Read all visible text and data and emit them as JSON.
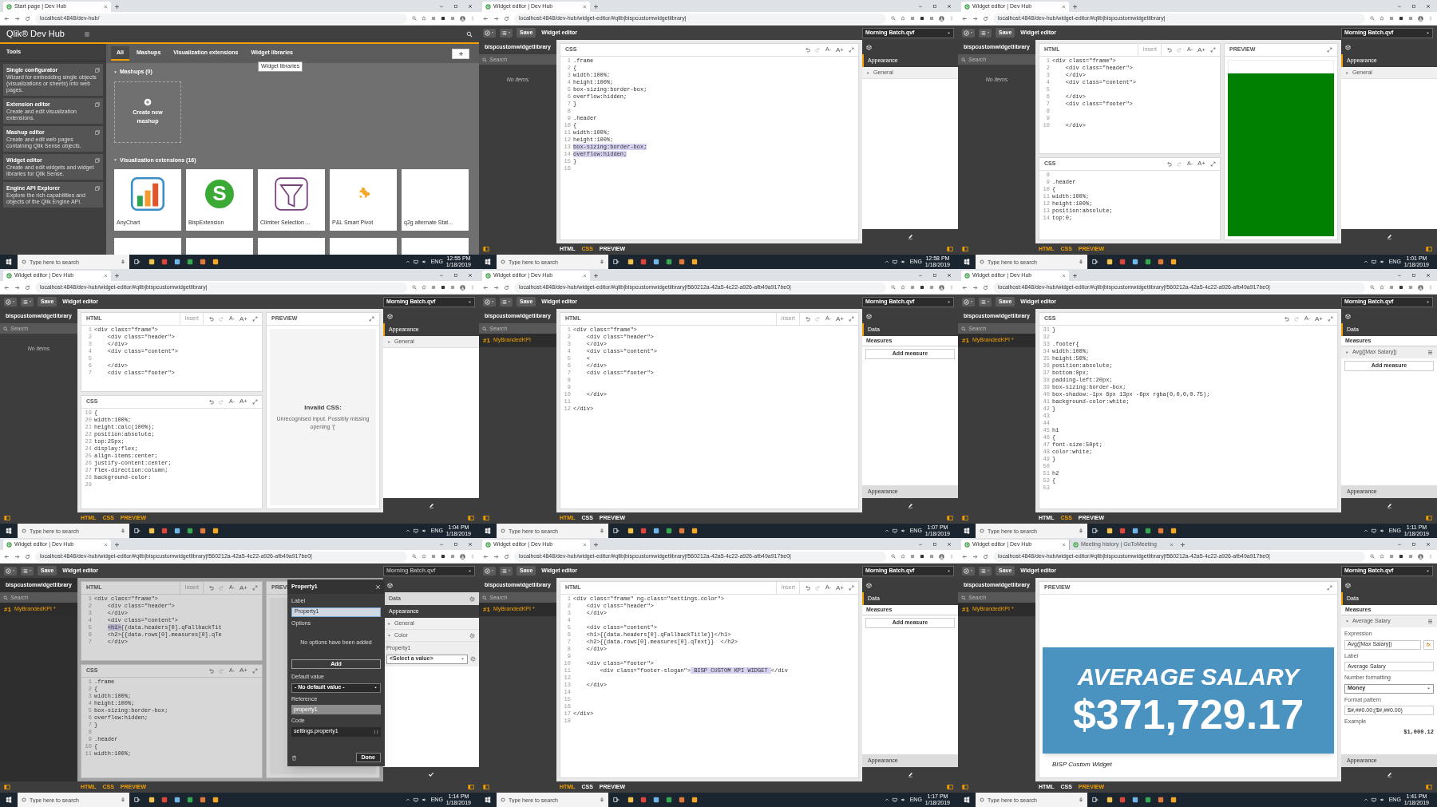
{
  "tiles": [
    {
      "kind": "devhub",
      "browser": {
        "tabs": [
          {
            "title": "Start page | Dev Hub",
            "selected": true
          }
        ],
        "url": "localhost:4848/dev-hub/"
      },
      "brand": "Qlik® Dev Hub",
      "tools_title": "Tools",
      "tools": [
        {
          "title": "Single configurator",
          "description": "Wizard for embedding single objects (visualizations or sheets) into web pages."
        },
        {
          "title": "Extension editor",
          "description": "Create and edit visualization extensions."
        },
        {
          "title": "Mashup editor",
          "description": "Create and edit web pages containing Qlik Sense objects."
        },
        {
          "title": "Widget editor",
          "description": "Create and edit widgets and widget libraries for Qlik Sense."
        },
        {
          "title": "Engine API Explorer",
          "description": "Explore the rich capabilities and objects of the Qlik Engine API."
        }
      ],
      "filter_tabs": [
        {
          "label": "All",
          "selected": true
        },
        {
          "label": "Mashups",
          "selected": false
        },
        {
          "label": "Visualization extensions",
          "selected": false
        },
        {
          "label": "Widget libraries",
          "selected": false
        }
      ],
      "tooltip": "Widget libraries",
      "sections": [
        {
          "title": "Mashups (0)",
          "expanded": true,
          "cards": [
            {
              "kind": "create",
              "name": "Create new mashup"
            }
          ]
        },
        {
          "title": "Visualization extensions (16)",
          "expanded": true,
          "cards": [
            {
              "kind": "bars",
              "name": "AnyChart"
            },
            {
              "kind": "letter",
              "letter": "S",
              "name": "BispExtension"
            },
            {
              "kind": "funnel",
              "name": "Climber Selection ..."
            },
            {
              "kind": "puzzle",
              "name": "P&L Smart Pivot"
            },
            {
              "kind": "plain",
              "name": "q2g alternate Stat..."
            }
          ]
        }
      ],
      "taskbar": {
        "search_placeholder": "Type here to search",
        "lang": "ENG",
        "time": "12:55 PM",
        "date": "1/18/2019"
      }
    },
    {
      "kind": "editor",
      "browser": {
        "tabs": [
          {
            "title": "Widget editor | Dev Hub",
            "selected": true
          }
        ],
        "url": "localhost:4848/dev-hub/widget-editor/#qlib|bispcustomwidgetlibrary|"
      },
      "toolbar": {
        "save": "Save",
        "title": "Widget editor",
        "app": "Morning Batch.qvf"
      },
      "library": {
        "title": "bispcustomwidgetlibrary",
        "search_placeholder": "Search",
        "empty_text": "No items"
      },
      "columns": [
        {
          "panels": [
            {
              "kind": "code",
              "title": "CSS",
              "font_buttons": [
                "A-",
                "A+"
              ],
              "lines": [
                {
                  "n": "1",
                  "text": ".frame"
                },
                {
                  "n": "2",
                  "text": "{"
                },
                {
                  "n": "3",
                  "text": "width:100%;"
                },
                {
                  "n": "4",
                  "text": "height:100%;"
                },
                {
                  "n": "5",
                  "text": "box-sizing:border-box;"
                },
                {
                  "n": "6",
                  "text": "overflow:hidden;"
                },
                {
                  "n": "7",
                  "text": "}"
                },
                {
                  "n": "8"
                },
                {
                  "n": "9",
                  "text": ".header"
                },
                {
                  "n": "10",
                  "text": "{"
                },
                {
                  "n": "11",
                  "text": "width:100%;"
                },
                {
                  "n": "12",
                  "text": "height:100%;"
                },
                {
                  "n": "13",
                  "segments": [
                    {
                      "text": "box-sizing:border-box;",
                      "selected": true
                    }
                  ]
                },
                {
                  "n": "14",
                  "segments": [
                    {
                      "text": "overflow:hidden;",
                      "selected": true
                    }
                  ]
                },
                {
                  "n": "15",
                  "text": "}"
                },
                {
                  "n": "16"
                }
              ]
            }
          ]
        }
      ],
      "properties": {
        "top": [
          {
            "kind": "header",
            "label": "Appearance",
            "selected": true
          },
          {
            "kind": "section",
            "label": "General",
            "expanded": false
          }
        ],
        "footer": {
          "kind": "pencil"
        }
      },
      "view_tabs": [
        {
          "label": "HTML",
          "selected": false
        },
        {
          "label": "CSS",
          "selected": true
        },
        {
          "label": "PREVIEW",
          "selected": false
        }
      ],
      "taskbar": {
        "search_placeholder": "Type here to search",
        "lang": "ENG",
        "time": "12:58 PM",
        "date": "1/18/2019"
      }
    },
    {
      "kind": "editor",
      "browser": {
        "tabs": [
          {
            "title": "Widget editor | Dev Hub",
            "selected": true
          }
        ],
        "url": "localhost:4848/dev-hub/widget-editor/#qlib|bispcustomwidgetlibrary|"
      },
      "toolbar": {
        "save": "Save",
        "title": "Widget editor",
        "app": "Morning Batch.qvf"
      },
      "library": {
        "title": "bispcustomwidgetlibrary",
        "search_placeholder": "Search",
        "empty_text": "No items"
      },
      "columns": [
        {
          "panels": [
            {
              "kind": "code",
              "title": "HTML",
              "insert": "Insert",
              "font_buttons": [
                "A-",
                "A+"
              ],
              "lines": [
                {
                  "n": "1",
                  "text": "<div class=\"frame\">"
                },
                {
                  "n": "2",
                  "text": "    <div class=\"header\">"
                },
                {
                  "n": "3",
                  "text": "    </div>"
                },
                {
                  "n": "4",
                  "text": "    <div class=\"content\">"
                },
                {
                  "n": "5"
                },
                {
                  "n": "6",
                  "text": "    </div>"
                },
                {
                  "n": "7",
                  "text": "    <div class=\"footer\">"
                },
                {
                  "n": "8"
                },
                {
                  "n": "9"
                },
                {
                  "n": "10",
                  "text": "    </div>"
                }
              ]
            },
            {
              "kind": "code",
              "title": "CSS",
              "font_buttons": [
                "A-",
                "A+"
              ],
              "lines": [
                {
                  "n": "8"
                },
                {
                  "n": "9",
                  "text": ".header"
                },
                {
                  "n": "10",
                  "text": "{"
                },
                {
                  "n": "11",
                  "text": "width:100%;"
                },
                {
                  "n": "12",
                  "text": "height:100%;"
                },
                {
                  "n": "13",
                  "text": "position:absolute;"
                },
                {
                  "n": "14",
                  "text": "top:0;"
                }
              ]
            }
          ]
        },
        {
          "panels": [
            {
              "kind": "preview",
              "title": "PREVIEW",
              "content": {
                "kind": "solid"
              }
            }
          ]
        }
      ],
      "properties": {
        "top": [
          {
            "kind": "header",
            "label": "Appearance",
            "selected": true
          },
          {
            "kind": "section",
            "label": "General",
            "expanded": false
          }
        ],
        "footer": {
          "kind": "pencil"
        }
      },
      "view_tabs": [
        {
          "label": "HTML",
          "selected": true
        },
        {
          "label": "CSS",
          "selected": true
        },
        {
          "label": "PREVIEW",
          "selected": true
        }
      ],
      "taskbar": {
        "search_placeholder": "Type here to search",
        "lang": "ENG",
        "time": "1:01 PM",
        "date": "1/18/2019"
      }
    },
    {
      "kind": "editor",
      "browser": {
        "tabs": [
          {
            "title": "Widget editor | Dev Hub",
            "selected": true
          }
        ],
        "url": "localhost:4848/dev-hub/widget-editor/#qlib|bispcustomwidgetlibrary|"
      },
      "toolbar": {
        "save": "Save",
        "title": "Widget editor",
        "app": "Morning Batch.qvf"
      },
      "library": {
        "title": "bispcustomwidgetlibrary",
        "search_placeholder": "Search",
        "empty_text": "No items"
      },
      "columns": [
        {
          "panels": [
            {
              "kind": "code",
              "title": "HTML",
              "insert": "Insert",
              "font_buttons": [
                "A-",
                "A+"
              ],
              "lines": [
                {
                  "n": "1",
                  "text": "<div class=\"frame\">"
                },
                {
                  "n": "2",
                  "text": "    <div class=\"header\">"
                },
                {
                  "n": "3",
                  "text": "    </div>"
                },
                {
                  "n": "4",
                  "text": "    <div class=\"content\">"
                },
                {
                  "n": "5"
                },
                {
                  "n": "6",
                  "text": "    </div>"
                },
                {
                  "n": "7",
                  "text": "    <div class=\"footer\">"
                }
              ]
            },
            {
              "kind": "code",
              "title": "CSS",
              "font_buttons": [
                "A-",
                "A+"
              ],
              "lines": [
                {
                  "n": "19",
                  "text": "{"
                },
                {
                  "n": "20",
                  "text": "width:100%;"
                },
                {
                  "n": "21",
                  "text": "height:calc(100%);"
                },
                {
                  "n": "22",
                  "text": "position:absolute;"
                },
                {
                  "n": "23",
                  "text": "top:25px;"
                },
                {
                  "n": "24",
                  "text": "display:flex;"
                },
                {
                  "n": "25",
                  "text": "align-items:center;"
                },
                {
                  "n": "26",
                  "text": "justify-content:center;"
                },
                {
                  "n": "27",
                  "text": "flex-direction:column;"
                },
                {
                  "n": "28",
                  "text": "background-color:"
                },
                {
                  "n": "29"
                }
              ]
            }
          ]
        },
        {
          "panels": [
            {
              "kind": "preview",
              "title": "PREVIEW",
              "content": {
                "kind": "message",
                "title": "Invalid CSS:",
                "text": "Unrecognised input. Possibly missing opening '{'"
              }
            }
          ]
        }
      ],
      "properties": {
        "top": [
          {
            "kind": "header",
            "label": "Appearance",
            "selected": true
          },
          {
            "kind": "section",
            "label": "General",
            "expanded": false
          }
        ],
        "footer": {
          "kind": "pencil"
        }
      },
      "view_tabs": [
        {
          "label": "HTML",
          "selected": true
        },
        {
          "label": "CSS",
          "selected": true
        },
        {
          "label": "PREVIEW",
          "selected": true
        }
      ],
      "taskbar": {
        "search_placeholder": "Type here to search",
        "lang": "ENG",
        "time": "1:04 PM",
        "date": "1/18/2019"
      }
    },
    {
      "kind": "editor",
      "browser": {
        "tabs": [
          {
            "title": "Widget editor | Dev Hub",
            "selected": true
          }
        ],
        "url": "localhost:4848/dev-hub/widget-editor/#qlib|bispcustomwidgetlibrary|f560212a-42a5-4c22-a926-afb49a917be0|"
      },
      "toolbar": {
        "save": "Save",
        "title": "Widget editor",
        "app": "Morning Batch.qvf"
      },
      "library": {
        "title": "bispcustomwidgetlibrary",
        "search_placeholder": "Search",
        "items": [
          {
            "number": "#1",
            "name": "MyBrandedKPI",
            "selected": true
          }
        ]
      },
      "columns": [
        {
          "panels": [
            {
              "kind": "code",
              "title": "HTML",
              "insert": "Insert",
              "font_buttons": [
                "A-",
                "A+"
              ],
              "lines": [
                {
                  "n": "1",
                  "text": "<div class=\"frame\">"
                },
                {
                  "n": "2",
                  "text": "    <div class=\"header\">"
                },
                {
                  "n": "3",
                  "text": "    </div>"
                },
                {
                  "n": "4",
                  "text": "    <div class=\"content\">"
                },
                {
                  "n": "5",
                  "text": "    <"
                },
                {
                  "n": "6",
                  "text": "    </div>"
                },
                {
                  "n": "7",
                  "text": "    <div class=\"footer\">"
                },
                {
                  "n": "8"
                },
                {
                  "n": "9"
                },
                {
                  "n": "10",
                  "text": "    </div>"
                },
                {
                  "n": "11"
                },
                {
                  "n": "12",
                  "text": "</div>"
                }
              ]
            }
          ]
        }
      ],
      "properties": {
        "top": [
          {
            "kind": "header",
            "label": "Data",
            "selected": true
          },
          {
            "kind": "subheader",
            "label": "Measures"
          },
          {
            "kind": "button",
            "label": "Add measure"
          }
        ],
        "bottom": [
          {
            "kind": "header",
            "label": "Appearance",
            "selected": false
          }
        ],
        "footer": {
          "kind": "pencil"
        }
      },
      "view_tabs": [
        {
          "label": "HTML",
          "selected": true
        },
        {
          "label": "CSS",
          "selected": false
        },
        {
          "label": "PREVIEW",
          "selected": false
        }
      ],
      "taskbar": {
        "search_placeholder": "Type here to search",
        "lang": "ENG",
        "time": "1:07 PM",
        "date": "1/18/2019"
      }
    },
    {
      "kind": "editor",
      "browser": {
        "tabs": [
          {
            "title": "Widget editor | Dev Hub",
            "selected": true
          }
        ],
        "url": "localhost:4848/dev-hub/widget-editor/#qlib|bispcustomwidgetlibrary|f560212a-42a5-4c22-a926-afb49a917be0|"
      },
      "toolbar": {
        "save": "Save",
        "title": "Widget editor",
        "app": "Morning Batch.qvf"
      },
      "library": {
        "title": "bispcustomwidgetlibrary",
        "search_placeholder": "Search",
        "items": [
          {
            "number": "#1",
            "name": "MyBrandedKPI *",
            "selected": true
          }
        ]
      },
      "columns": [
        {
          "panels": [
            {
              "kind": "code",
              "title": "CSS",
              "font_buttons": [
                "A-",
                "A+"
              ],
              "lines": [
                {
                  "n": "31",
                  "text": "}"
                },
                {
                  "n": "32"
                },
                {
                  "n": "33",
                  "text": ".footer{"
                },
                {
                  "n": "34",
                  "text": "width:100%;"
                },
                {
                  "n": "35",
                  "text": "height:50%;"
                },
                {
                  "n": "36",
                  "text": "position:absolute;"
                },
                {
                  "n": "37",
                  "text": "bottom:0px;"
                },
                {
                  "n": "38",
                  "text": "padding-left:20px;"
                },
                {
                  "n": "39",
                  "text": "box-sizing:border-box;"
                },
                {
                  "n": "40",
                  "text": "box-shadow:-1px 6px 13px -6px rgba(0,0,0,0.75);"
                },
                {
                  "n": "41",
                  "text": "background-color:white;"
                },
                {
                  "n": "42",
                  "text": "}"
                },
                {
                  "n": "43"
                },
                {
                  "n": "44"
                },
                {
                  "n": "45",
                  "text": "h1"
                },
                {
                  "n": "46",
                  "text": "{"
                },
                {
                  "n": "47",
                  "text": "font-size:50pt;"
                },
                {
                  "n": "48",
                  "text": "color:white;"
                },
                {
                  "n": "49",
                  "text": "}"
                },
                {
                  "n": "50"
                },
                {
                  "n": "51",
                  "text": "h2"
                },
                {
                  "n": "52",
                  "text": "{"
                },
                {
                  "n": "53"
                }
              ]
            }
          ]
        }
      ],
      "properties": {
        "top": [
          {
            "kind": "header",
            "label": "Data",
            "selected": true
          },
          {
            "kind": "subheader",
            "label": "Measures"
          },
          {
            "kind": "measure",
            "label": "Avg([Max Salary])",
            "expanded": false
          },
          {
            "kind": "button",
            "label": "Add measure"
          }
        ],
        "bottom": [
          {
            "kind": "header",
            "label": "Appearance",
            "selected": false
          }
        ],
        "footer": {
          "kind": "pencil"
        }
      },
      "view_tabs": [
        {
          "label": "HTML",
          "selected": false
        },
        {
          "label": "CSS",
          "selected": true
        },
        {
          "label": "PREVIEW",
          "selected": false
        }
      ],
      "taskbar": {
        "search_placeholder": "Type here to search",
        "lang": "ENG",
        "time": "1:11 PM",
        "date": "1/18/2019"
      }
    },
    {
      "kind": "editor",
      "browser": {
        "tabs": [
          {
            "title": "Widget editor | Dev Hub",
            "selected": true
          }
        ],
        "url": "localhost:4848/dev-hub/widget-editor/#qlib|bispcustomwidgetlibrary|f560212a-42a5-4c22-a926-afb49a917be0|"
      },
      "toolbar": {
        "save": "Save",
        "title": "Widget editor",
        "app": "Morning Batch.qvf"
      },
      "library": {
        "title": "bispcustomwidgetlibrary",
        "search_placeholder": "Search",
        "items": [
          {
            "number": "#1",
            "name": "MyBrandedKPI *",
            "selected": true
          }
        ]
      },
      "columns": [
        {
          "panels": [
            {
              "kind": "code",
              "title": "HTML",
              "insert": "Insert",
              "font_buttons": [
                "A-",
                "A+"
              ],
              "lines": [
                {
                  "n": "1",
                  "text": "<div class=\"frame\">"
                },
                {
                  "n": "2",
                  "text": "    <div class=\"header\">"
                },
                {
                  "n": "3",
                  "text": "    </div>"
                },
                {
                  "n": "4",
                  "text": "    <div class=\"content\">"
                },
                {
                  "n": "5",
                  "indented": true,
                  "segments": [
                    {
                      "text": "<h1>",
                      "selected": true
                    },
                    {
                      "text": "{{data.headers[0].qFallbackTit",
                      "selected": false
                    }
                  ]
                },
                {
                  "n": "6",
                  "text": "    <h2>{{data.rows[0].measures[0].qTe"
                },
                {
                  "n": "7",
                  "text": "    </div>"
                }
              ]
            },
            {
              "kind": "code",
              "title": "CSS",
              "font_buttons": [
                "A-",
                "A+"
              ],
              "lines": [
                {
                  "n": "1",
                  "text": ".frame"
                },
                {
                  "n": "2",
                  "text": "{"
                },
                {
                  "n": "3",
                  "text": "width:100%;"
                },
                {
                  "n": "4",
                  "text": "height:100%;"
                },
                {
                  "n": "5",
                  "text": "box-sizing:border-box;"
                },
                {
                  "n": "6",
                  "text": "overflow:hidden;"
                },
                {
                  "n": "7",
                  "text": "}"
                },
                {
                  "n": "8"
                },
                {
                  "n": "9",
                  "text": ".header"
                },
                {
                  "n": "10",
                  "text": "{"
                },
                {
                  "n": "11",
                  "text": "width:100%;"
                }
              ]
            }
          ]
        },
        {
          "panels": [
            {
              "kind": "preview",
              "title": "PREVI",
              "content": {
                "kind": "empty"
              }
            }
          ]
        }
      ],
      "dialog": {
        "title": "Property1",
        "fields": [
          {
            "kind": "input",
            "label": "Label",
            "value": "Property1"
          },
          {
            "kind": "options",
            "label": "Options",
            "text": "No options have been added"
          },
          {
            "kind": "button",
            "label": "Add"
          },
          {
            "kind": "select",
            "label": "Default value",
            "value": "- No default value -"
          },
          {
            "kind": "readonly",
            "label": "Reference",
            "value": "property1"
          },
          {
            "kind": "code",
            "label": "Code",
            "value": "settings.property1"
          }
        ],
        "done": "Done"
      },
      "properties": {
        "top": [
          {
            "kind": "header",
            "label": "Data",
            "selected": false,
            "gear": true
          },
          {
            "kind": "header",
            "label": "Appearance",
            "selected": true
          },
          {
            "kind": "section",
            "label": "General",
            "expanded": false
          },
          {
            "kind": "section",
            "label": "Color",
            "expanded": true,
            "gear": true
          },
          {
            "kind": "select",
            "label": "Property1",
            "value": "<Select a value>",
            "gear": true
          }
        ],
        "footer": {
          "kind": "check"
        }
      },
      "view_tabs": [
        {
          "label": "HTML",
          "selected": true
        },
        {
          "label": "CSS",
          "selected": true
        },
        {
          "label": "PREVIEW",
          "selected": true
        }
      ],
      "taskbar": {
        "search_placeholder": "Type here to search",
        "lang": "ENG",
        "time": "1:14 PM",
        "date": "1/18/2019"
      }
    },
    {
      "kind": "editor",
      "browser": {
        "tabs": [
          {
            "title": "Widget editor | Dev Hub",
            "selected": true
          }
        ],
        "url": "localhost:4848/dev-hub/widget-editor/#qlib|bispcustomwidgetlibrary|f560212a-42a5-4c22-a926-afb49a917be0|"
      },
      "toolbar": {
        "save": "Save",
        "title": "Widget editor",
        "app": "Morning Batch.qvf"
      },
      "library": {
        "title": "bispcustomwidgetlibrary",
        "search_placeholder": "Search",
        "items": [
          {
            "number": "#1",
            "name": "MyBrandedKPI *",
            "selected": true
          }
        ]
      },
      "columns": [
        {
          "panels": [
            {
              "kind": "code",
              "title": "HTML",
              "insert": "Insert",
              "font_buttons": [
                "A-",
                "A+"
              ],
              "lines": [
                {
                  "n": "1",
                  "text": "<div class=\"frame\" ng-class=\"settings.color\">"
                },
                {
                  "n": "2",
                  "text": "    <div class=\"header\">"
                },
                {
                  "n": "3",
                  "text": "    </div>"
                },
                {
                  "n": "4"
                },
                {
                  "n": "5",
                  "text": "    <div class=\"content\">"
                },
                {
                  "n": "6",
                  "text": "    <h1>{{data.headers[0].qFallbackTitle}}</h1>"
                },
                {
                  "n": "7",
                  "text": "    <h2>{{data.rows[0].measures[0].qText}}  </h2>"
                },
                {
                  "n": "8",
                  "text": "    </div>"
                },
                {
                  "n": "9"
                },
                {
                  "n": "10",
                  "text": "    <div class=\"footer\">"
                },
                {
                  "n": "11",
                  "segments": [
                    {
                      "text": "        <div class=\"footer-slogan\">",
                      "selected": false
                    },
                    {
                      "text": " BISP CUSTOM KPI WIDGET ",
                      "selected": true
                    },
                    {
                      "text": "</div",
                      "selected": false
                    }
                  ]
                },
                {
                  "n": "12"
                },
                {
                  "n": "13",
                  "text": "    </div>"
                },
                {
                  "n": "14"
                },
                {
                  "n": "15"
                },
                {
                  "n": "16"
                },
                {
                  "n": "17",
                  "text": "</div>"
                },
                {
                  "n": "18"
                }
              ]
            }
          ]
        }
      ],
      "properties": {
        "top": [
          {
            "kind": "header",
            "label": "Data",
            "selected": true
          },
          {
            "kind": "subheader",
            "label": "Measures"
          },
          {
            "kind": "button",
            "label": "Add measure"
          }
        ],
        "bottom": [
          {
            "kind": "header",
            "label": "Appearance",
            "selected": false
          }
        ],
        "footer": {
          "kind": "pencil"
        }
      },
      "view_tabs": [
        {
          "label": "HTML",
          "selected": true
        },
        {
          "label": "CSS",
          "selected": false
        },
        {
          "label": "PREVIEW",
          "selected": false
        }
      ],
      "taskbar": {
        "search_placeholder": "Type here to search",
        "lang": "ENG",
        "time": "1:17 PM",
        "date": "1/18/2019"
      }
    },
    {
      "kind": "editor",
      "browser": {
        "tabs": [
          {
            "title": "Widget editor | Dev Hub",
            "selected": true
          },
          {
            "title": "Meeting history | GoToMeeting",
            "selected": false
          }
        ],
        "url": "localhost:4848/dev-hub/widget-editor/#qlib|bispcustomwidgetlibrary|f560212a-42a5-4c22-a926-afb49a917be0|"
      },
      "toolbar": {
        "save": "Save",
        "title": "Widget editor",
        "app": "Morning Batch.qvf"
      },
      "library": {
        "title": "bispcustomwidgetlibrary",
        "search_placeholder": "Search",
        "items": [
          {
            "number": "#1",
            "name": "MyBrandedKPI *",
            "selected": true
          }
        ]
      },
      "columns": [
        {
          "panels": [
            {
              "kind": "preview",
              "title": "PREVIEW",
              "content": {
                "kind": "kpi",
                "title": "AVERAGE SALARY",
                "value": "$371,729.17",
                "caption": "BISP Custom Widget"
              }
            }
          ]
        }
      ],
      "properties": {
        "top": [
          {
            "kind": "header",
            "label": "Data",
            "selected": true
          },
          {
            "kind": "subheader",
            "label": "Measures"
          },
          {
            "kind": "measure",
            "label": "Average Salary",
            "expanded": true
          },
          {
            "kind": "input",
            "label": "Expression",
            "value": "Avg([Max Salary])",
            "button": "fx"
          },
          {
            "kind": "input",
            "label": "Label",
            "value": "Average Salary"
          },
          {
            "kind": "select",
            "label": "Number formatting",
            "value": "Money"
          },
          {
            "kind": "input",
            "label": "Format pattern",
            "value": "$#,##0.00;($#,##0.00)"
          },
          {
            "kind": "readout",
            "label": "Example",
            "value": "$1,000.12"
          }
        ],
        "bottom": [
          {
            "kind": "header",
            "label": "Appearance",
            "selected": false
          }
        ],
        "footer": {
          "kind": "pencil"
        }
      },
      "view_tabs": [
        {
          "label": "HTML",
          "selected": false
        },
        {
          "label": "CSS",
          "selected": false
        },
        {
          "label": "PREVIEW",
          "selected": true
        }
      ],
      "taskbar": {
        "search_placeholder": "Type here to search",
        "lang": "ENG",
        "time": "1:41 PM",
        "date": "1/18/2019"
      }
    }
  ]
}
